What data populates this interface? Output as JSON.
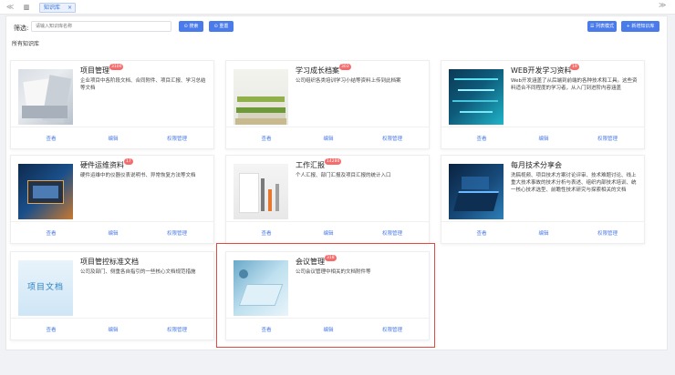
{
  "tabs": {
    "back_glyph": "≪",
    "home_glyph": "▥",
    "active_label": "知识库",
    "close_glyph": "×",
    "forward_glyph": "≫"
  },
  "toolbar": {
    "filter_label": "筛选:",
    "search_placeholder": "请输入知识库名称",
    "search_button": "⊙ 搜索",
    "reset_button": "⊙ 重置",
    "list_mode_button": "☰ 列表模式",
    "new_button": "+ 新增知识库"
  },
  "section_title": "所有知识库",
  "cards": [
    {
      "title": "项目管理",
      "badge": "3100",
      "desc": "企业项目中各阶段文档、合同附件、项目汇报、学习总结等文档",
      "view": "查看",
      "edit": "编辑",
      "perm": "权限管理"
    },
    {
      "title": "学习成长档案",
      "badge": "303",
      "desc": "公司组织各类培训学习小结等资料上传到此档案",
      "view": "查看",
      "edit": "编辑",
      "perm": "权限管理"
    },
    {
      "title": "WEB开发学习资料",
      "badge": "19",
      "desc": "Web开发涵盖了从后端到前端的各种技术和工具。这些资料适合不同程度的学习者，从入门到进阶内容涵盖",
      "view": "查看",
      "edit": "编辑",
      "perm": "权限管理"
    },
    {
      "title": "硬件运维资料",
      "badge": "17",
      "desc": "硬件运维中的仪器仪表说明书、异常恢复方法等文档",
      "view": "查看",
      "edit": "编辑",
      "perm": "权限管理"
    },
    {
      "title": "工作汇报",
      "badge": "14280",
      "desc": "个人汇报、部门汇报及项目汇报的统计入口",
      "view": "查看",
      "edit": "编辑",
      "perm": "权限管理"
    },
    {
      "title": "每月技术分享会",
      "badge": "",
      "desc": "洗稿视频、项目技术方案讨论评审、技术难题讨论、线上重大技术事故的技术分析与表述、组织内部技术培训、统一核心技术选型、前瞻性技术研究与探索相关的文档",
      "view": "查看",
      "edit": "编辑",
      "perm": "权限管理"
    },
    {
      "title": "项目管控标准文档",
      "badge": "",
      "desc": "公司及部门、侧重各自指引的一些核心文档规范措施",
      "view": "查看",
      "edit": "编辑",
      "perm": "权限管理",
      "thumb_text": "项目文档"
    },
    {
      "title": "会议管理",
      "badge": "318",
      "desc": "公司会议管理中相关的文档附件等",
      "view": "查看",
      "edit": "编辑",
      "perm": "权限管理"
    }
  ],
  "colors": {
    "accent": "#4a7bea",
    "badge": "#f56c6c",
    "highlight": "#e4493e"
  }
}
